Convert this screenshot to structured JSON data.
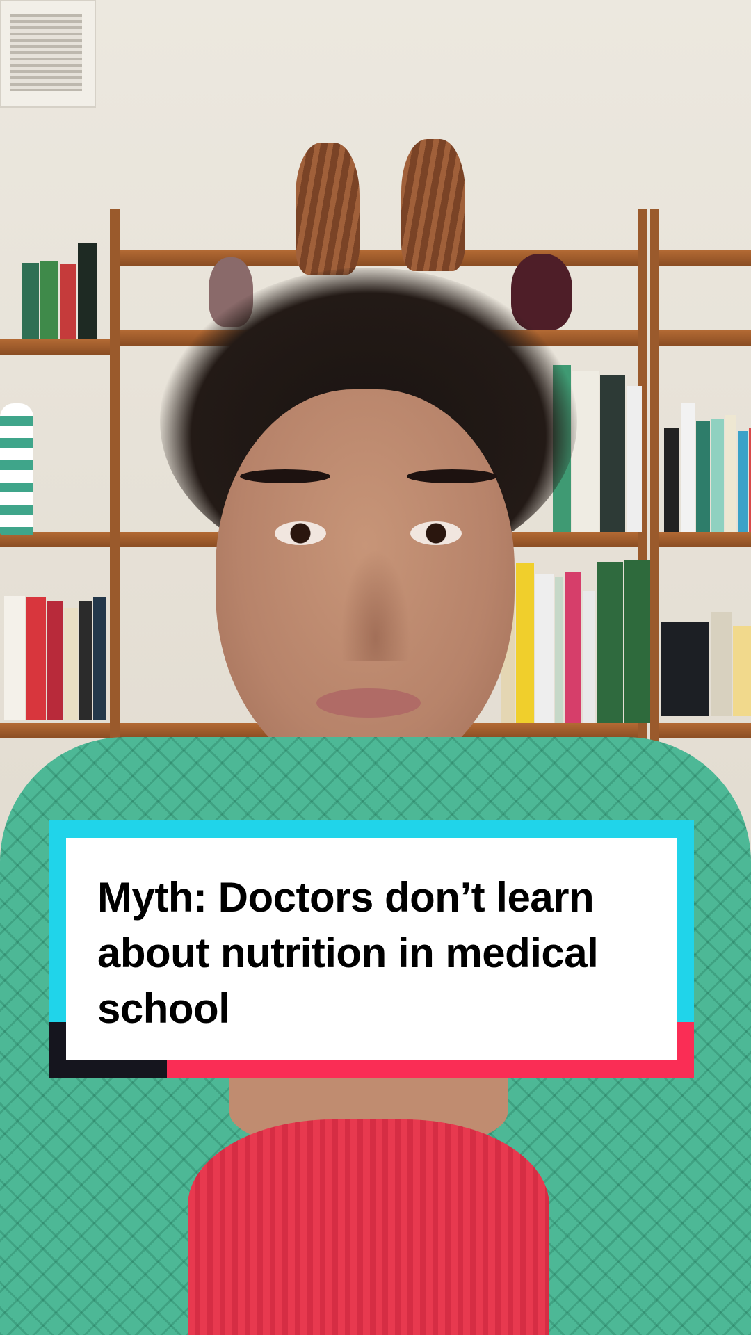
{
  "caption": {
    "text": "Myth: Doctors don’t learn about nutrition in medical school"
  },
  "colors": {
    "card_cyan": "#20d4ea",
    "card_red": "#fa2d55",
    "card_dark": "#15151e",
    "card_white": "#ffffff"
  }
}
